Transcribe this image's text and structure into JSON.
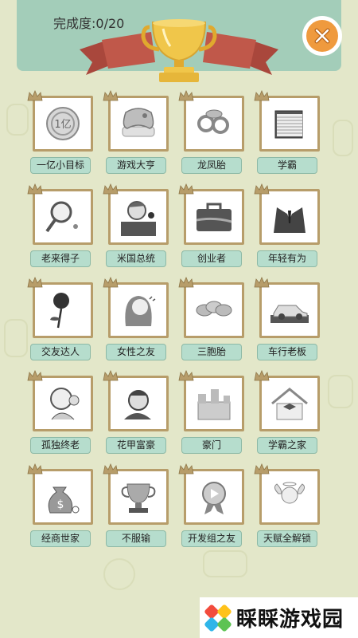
{
  "header": {
    "progress_label": "完成度:0/20"
  },
  "achievements": [
    {
      "label": "一亿小目标",
      "icon": "coin-icon"
    },
    {
      "label": "游戏大亨",
      "icon": "gamepad-icon"
    },
    {
      "label": "龙凤胎",
      "icon": "pacifier-icon"
    },
    {
      "label": "学霸",
      "icon": "book-icon"
    },
    {
      "label": "老来得子",
      "icon": "rattle-icon"
    },
    {
      "label": "米国总统",
      "icon": "president-icon"
    },
    {
      "label": "创业者",
      "icon": "briefcase-icon"
    },
    {
      "label": "年轻有为",
      "icon": "suit-icon"
    },
    {
      "label": "交友达人",
      "icon": "rose-icon"
    },
    {
      "label": "女性之友",
      "icon": "woman-icon"
    },
    {
      "label": "三胞胎",
      "icon": "triplets-icon"
    },
    {
      "label": "车行老板",
      "icon": "car-icon"
    },
    {
      "label": "孤独终老",
      "icon": "old-man-icon"
    },
    {
      "label": "花甲富豪",
      "icon": "rich-old-man-icon"
    },
    {
      "label": "豪门",
      "icon": "castle-icon"
    },
    {
      "label": "学霸之家",
      "icon": "graduation-house-icon"
    },
    {
      "label": "经商世家",
      "icon": "money-bag-icon"
    },
    {
      "label": "不服输",
      "icon": "trophy-icon"
    },
    {
      "label": "开发组之友",
      "icon": "medal-icon"
    },
    {
      "label": "天赋全解锁",
      "icon": "cupid-icon"
    }
  ],
  "brand": {
    "name": "睬睬游戏园"
  },
  "colors": {
    "background": "#e3e7c9",
    "header": "#a3cdb9",
    "close_button": "#ef9a3e",
    "ribbon": "#c0584a",
    "trophy": "#f0c64a",
    "card_border": "#b79d6a",
    "label_bg": "#b6ddcd"
  }
}
